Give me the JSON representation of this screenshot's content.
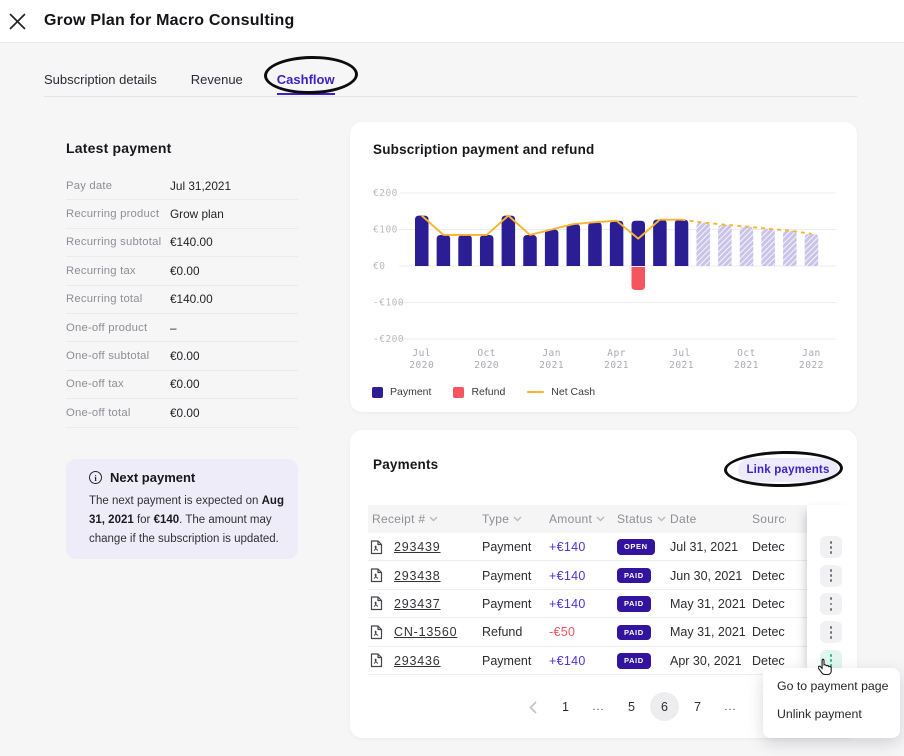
{
  "header": {
    "title": "Grow Plan for Macro Consulting"
  },
  "tabs": [
    {
      "label": "Subscription details",
      "active": false
    },
    {
      "label": "Revenue",
      "active": false
    },
    {
      "label": "Cashflow",
      "active": true
    }
  ],
  "latest_payment": {
    "title": "Latest payment",
    "rows": [
      {
        "label": "Pay date",
        "value": "Jul 31,2021"
      },
      {
        "label": "Recurring product",
        "value": "Grow plan"
      },
      {
        "label": "Recurring subtotal",
        "value": "€140.00"
      },
      {
        "label": "Recurring tax",
        "value": "€0.00"
      },
      {
        "label": "Recurring total",
        "value": "€140.00"
      },
      {
        "label": "One-off product",
        "value": "–"
      },
      {
        "label": "One-off subtotal",
        "value": "€0.00"
      },
      {
        "label": "One-off tax",
        "value": "€0.00"
      },
      {
        "label": "One-off total",
        "value": "€0.00"
      }
    ]
  },
  "next_payment": {
    "title": "Next payment",
    "body": [
      {
        "t": "The next payment is expected on ",
        "b": false
      },
      {
        "t": "Aug 31, 2021",
        "b": true
      },
      {
        "t": " for ",
        "b": false
      },
      {
        "t": "€140",
        "b": true
      },
      {
        "t": ". The amount may change if the subscription is updated.",
        "b": false
      }
    ]
  },
  "chart_card": {
    "title": "Subscription payment and refund"
  },
  "chart_data": {
    "type": "bar",
    "title": "Subscription payment and refund",
    "months": [
      "Jul 2020",
      "Aug 2020",
      "Sep 2020",
      "Oct 2020",
      "Nov 2020",
      "Dec 2020",
      "Jan 2021",
      "Feb 2021",
      "Mar 2021",
      "Apr 2021",
      "May 2021",
      "Jun 2021",
      "Jul 2021",
      "Aug 2021",
      "Sep 2021",
      "Oct 2021",
      "Nov 2021",
      "Dec 2021",
      "Jan 2022"
    ],
    "payment": [
      138,
      85,
      85,
      85,
      138,
      85,
      100,
      115,
      120,
      124,
      124,
      127,
      127,
      119,
      113,
      108,
      102,
      97,
      88
    ],
    "forecast_from_index": 13,
    "refund": {
      "month": "May 2021",
      "index": 10,
      "value": -63
    },
    "net_cash": [
      138,
      85,
      85,
      85,
      138,
      85,
      100,
      115,
      120,
      124,
      75,
      127,
      127,
      119,
      113,
      108,
      102,
      97,
      88
    ],
    "ylim": [
      -200,
      200
    ],
    "yticks": [
      "€200",
      "€100",
      "€0",
      "-€100",
      "-€200"
    ],
    "xtick_indices": [
      0,
      3,
      6,
      9,
      12,
      15,
      18
    ],
    "xtick_labels": [
      [
        "Jul",
        "2020"
      ],
      [
        "Oct",
        "2020"
      ],
      [
        "Jan",
        "2021"
      ],
      [
        "Apr",
        "2021"
      ],
      [
        "Jul",
        "2021"
      ],
      [
        "Oct",
        "2021"
      ],
      [
        "Jan",
        "2022"
      ]
    ],
    "legend": [
      {
        "label": "Payment",
        "color": "#2b1d93",
        "kind": "square"
      },
      {
        "label": "Refund",
        "color": "#f4555f",
        "kind": "square"
      },
      {
        "label": "Net Cash",
        "color": "#fab42e",
        "kind": "line"
      }
    ],
    "colors": {
      "payment": "#2b1d93",
      "forecast": "#c9c3ea",
      "refund": "#f4555f",
      "net": "#fab42e"
    }
  },
  "payments": {
    "title": "Payments",
    "link_button": "Link payments",
    "columns": [
      {
        "label": "Receipt #",
        "sort": true
      },
      {
        "label": "Type",
        "sort": true
      },
      {
        "label": "Amount",
        "sort": true
      },
      {
        "label": "Status",
        "sort": true
      },
      {
        "label": "Date",
        "sort": false
      },
      {
        "label": "Source",
        "sort": false
      }
    ],
    "rows": [
      {
        "receipt": "293439",
        "type": "Payment",
        "amount": "+€140",
        "negative": false,
        "status": "OPEN",
        "date": "Jul 31, 2021",
        "source": "Detected"
      },
      {
        "receipt": "293438",
        "type": "Payment",
        "amount": "+€140",
        "negative": false,
        "status": "PAID",
        "date": "Jun 30, 2021",
        "source": "Detected"
      },
      {
        "receipt": "293437",
        "type": "Payment",
        "amount": "+€140",
        "negative": false,
        "status": "PAID",
        "date": "May 31, 2021",
        "source": "Detected"
      },
      {
        "receipt": "CN-13560",
        "type": "Refund",
        "amount": "-€50",
        "negative": true,
        "status": "PAID",
        "date": "May 31, 2021",
        "source": "Detected"
      },
      {
        "receipt": "293436",
        "type": "Payment",
        "amount": "+€140",
        "negative": false,
        "status": "PAID",
        "date": "Apr 30, 2021",
        "source": "Detected"
      }
    ],
    "pagination": [
      "1",
      "...",
      "5",
      "6",
      "7",
      "..."
    ],
    "active_page": "6",
    "menu_items": [
      "Go to payment page",
      "Unlink payment"
    ]
  }
}
